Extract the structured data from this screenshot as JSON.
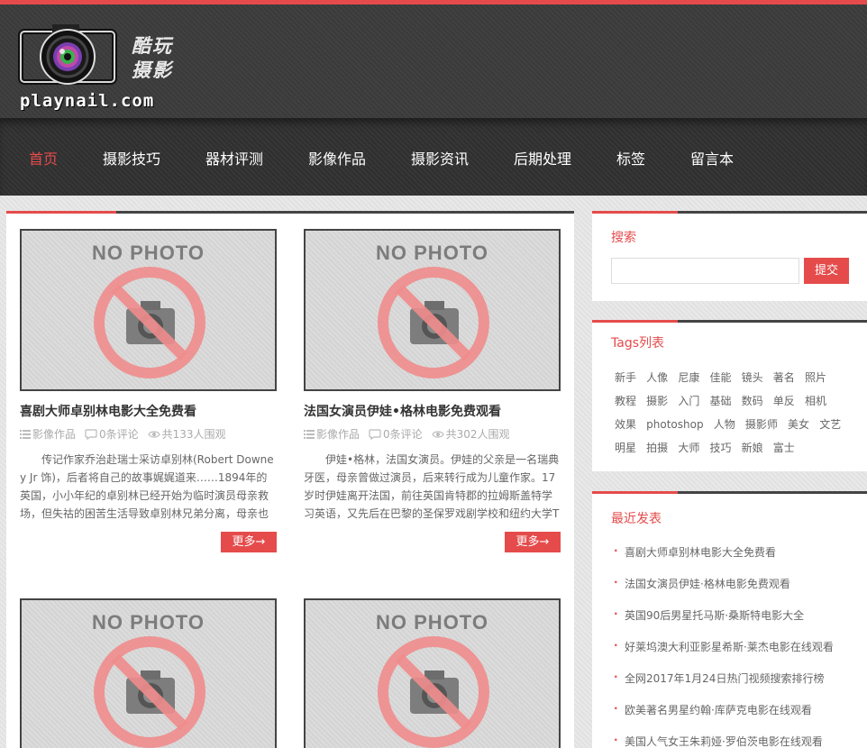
{
  "header": {
    "logo_cn": "酷玩摄影",
    "logo_url": "playnail.com"
  },
  "nav": {
    "items": [
      "首页",
      "摄影技巧",
      "器材评测",
      "影像作品",
      "摄影资讯",
      "后期处理",
      "标签",
      "留言本"
    ],
    "active": "首页"
  },
  "placeholder_text": "NO PHOTO",
  "posts": [
    {
      "title": "喜剧大师卓别林电影大全免费看",
      "category": "影像作品",
      "comments": "0条评论",
      "views": "共133人围观",
      "excerpt": "传记作家乔治赴瑞士采访卓别林(Robert Downey Jr 饰)，后者将自己的故事娓娓道来……1894年的英国，小小年纪的卓别林已经开始为临时演员母亲救场，但失祜的困苦生活导致卓别林兄弟分离，母亲也",
      "more": "更多→"
    },
    {
      "title": "法国女演员伊娃•格林电影免费观看",
      "category": "影像作品",
      "comments": "0条评论",
      "views": "共302人围观",
      "excerpt": "伊娃•格林，法国女演员。伊娃的父亲是一名瑞典牙医，母亲曾做过演员，后来转行成为儿童作家。17岁时伊娃离开法国，前往英国肯特郡的拉姆斯盖特学习英语，又先后在巴黎的圣保罗戏剧学校和纽约大学T",
      "more": "更多→"
    }
  ],
  "sidebar": {
    "search": {
      "title": "搜索",
      "button": "提交",
      "value": ""
    },
    "tags": {
      "title": "Tags列表",
      "items": [
        "新手",
        "人像",
        "尼康",
        "佳能",
        "镜头",
        "著名",
        "照片",
        "教程",
        "摄影",
        "入门",
        "基础",
        "数码",
        "单反",
        "相机",
        "效果",
        "photoshop",
        "人物",
        "摄影师",
        "美女",
        "文艺",
        "明星",
        "拍摄",
        "大师",
        "技巧",
        "新娘",
        "富士"
      ]
    },
    "recent": {
      "title": "最近发表",
      "items": [
        "喜剧大师卓别林电影大全免费看",
        "法国女演员伊娃·格林电影免费观看",
        "英国90后男星托马斯·桑斯特电影大全",
        "好莱坞澳大利亚影星希斯·莱杰电影在线观看",
        "全网2017年1月24日热门视频搜索排行榜",
        "欧美著名男星约翰·库萨克电影在线观看",
        "美国人气女王朱莉娅·罗伯茨电影在线观看"
      ]
    }
  },
  "colors": {
    "accent": "#e54b4b",
    "header_bg": "#3a3a3a",
    "nav_text": "#ffffff"
  }
}
